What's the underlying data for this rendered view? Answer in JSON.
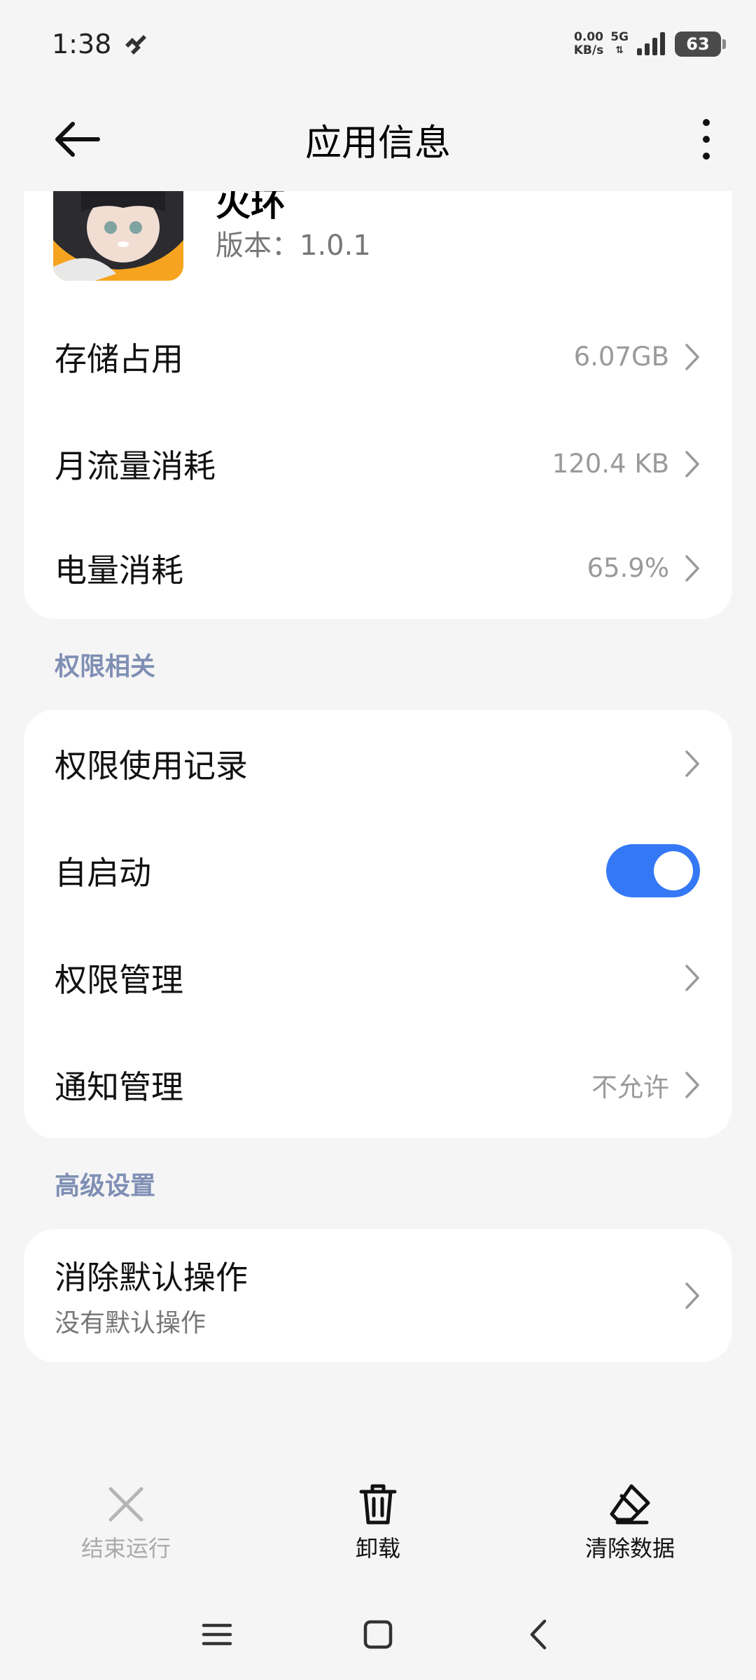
{
  "status_bar": {
    "time": "1:38",
    "net_speed_value": "0.00",
    "net_speed_unit": "KB/s",
    "network": "5G",
    "battery": "63"
  },
  "app_bar": {
    "title": "应用信息"
  },
  "app": {
    "name": "火环",
    "version": "版本：1.0.1"
  },
  "usage": [
    {
      "label": "存储占用",
      "value": "6.07GB"
    },
    {
      "label": "月流量消耗",
      "value": "120.4 KB"
    },
    {
      "label": "电量消耗",
      "value": "65.9%"
    }
  ],
  "permissions": {
    "title": "权限相关",
    "items": [
      {
        "label": "权限使用记录",
        "value": ""
      },
      {
        "label": "自启动",
        "toggle": true
      },
      {
        "label": "权限管理",
        "value": ""
      },
      {
        "label": "通知管理",
        "value": "不允许"
      }
    ]
  },
  "advanced": {
    "title": "高级设置",
    "item_label": "消除默认操作",
    "item_sub": "没有默认操作"
  },
  "actions": [
    {
      "label": "结束运行",
      "enabled": false
    },
    {
      "label": "卸载",
      "enabled": true
    },
    {
      "label": "清除数据",
      "enabled": true
    }
  ],
  "colors": {
    "accent": "#3478f6",
    "section_title": "#7f8fb4",
    "background": "#f5f5f5"
  }
}
